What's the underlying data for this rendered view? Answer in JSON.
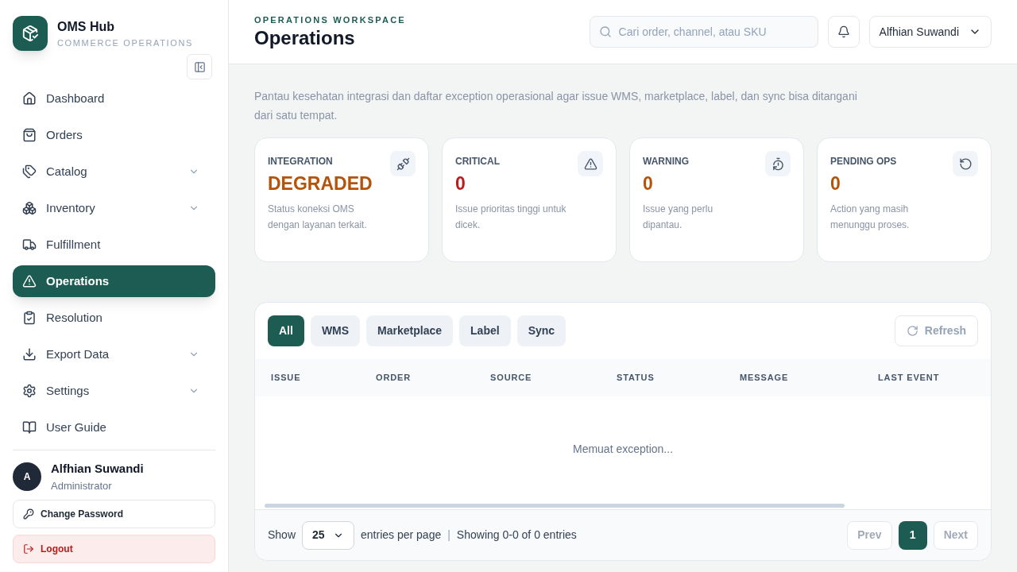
{
  "brand": {
    "name": "OMS Hub",
    "subtitle": "COMMERCE OPERATIONS"
  },
  "nav": [
    {
      "kind": "home",
      "label": "Dashboard",
      "selected": false,
      "submenu": false
    },
    {
      "kind": "orders",
      "label": "Orders",
      "selected": false,
      "submenu": false
    },
    {
      "kind": "catalog",
      "label": "Catalog",
      "selected": false,
      "submenu": true
    },
    {
      "kind": "inventory",
      "label": "Inventory",
      "selected": false,
      "submenu": true
    },
    {
      "kind": "fulfillment",
      "label": "Fulfillment",
      "selected": false,
      "submenu": false
    },
    {
      "kind": "operations",
      "label": "Operations",
      "selected": true,
      "submenu": false
    },
    {
      "kind": "resolution",
      "label": "Resolution",
      "selected": false,
      "submenu": false
    },
    {
      "kind": "export",
      "label": "Export Data",
      "selected": false,
      "submenu": true
    },
    {
      "kind": "settings",
      "label": "Settings",
      "selected": false,
      "submenu": true
    },
    {
      "kind": "guide",
      "label": "User Guide",
      "selected": false,
      "submenu": false
    }
  ],
  "user": {
    "initial": "A",
    "name": "Alfhian Suwandi",
    "role": "Administrator"
  },
  "sidebar_buttons": {
    "change_password": "Change Password",
    "logout": "Logout"
  },
  "header": {
    "eyebrow": "OPERATIONS WORKSPACE",
    "title": "Operations",
    "search_placeholder": "Cari order, channel, atau SKU",
    "user_menu": "Alfhian Suwandi"
  },
  "intro": "Pantau kesehatan integrasi dan daftar exception operasional agar issue WMS, marketplace, label, dan sync bisa ditangani dari satu tempat.",
  "stats": [
    {
      "kind": "integration",
      "label": "INTEGRATION",
      "value": "DEGRADED",
      "description": "Status koneksi OMS dengan layanan terkait."
    },
    {
      "kind": "critical",
      "label": "CRITICAL",
      "value": "0",
      "description": "Issue prioritas tinggi untuk dicek."
    },
    {
      "kind": "warning",
      "label": "WARNING",
      "value": "0",
      "description": "Issue yang perlu dipantau."
    },
    {
      "kind": "pending",
      "label": "PENDING OPS",
      "value": "0",
      "description": "Action yang masih menunggu proses."
    }
  ],
  "filters": [
    {
      "label": "All",
      "selected": true
    },
    {
      "label": "WMS",
      "selected": false
    },
    {
      "label": "Marketplace",
      "selected": false
    },
    {
      "label": "Label",
      "selected": false
    },
    {
      "label": "Sync",
      "selected": false
    }
  ],
  "refresh": {
    "label": "Refresh",
    "disabled": true
  },
  "table": {
    "columns": [
      "ISSUE",
      "ORDER",
      "SOURCE",
      "STATUS",
      "MESSAGE",
      "LAST EVENT"
    ],
    "empty_message": "Memuat exception..."
  },
  "footer": {
    "show": "Show",
    "page_size": "25",
    "per_page": "entries per page",
    "separator": "|",
    "summary": "Showing 0-0 of 0 entries"
  },
  "pagination": [
    {
      "label": "Prev",
      "disabled": true,
      "selected": false
    },
    {
      "label": "1",
      "disabled": false,
      "selected": true
    },
    {
      "label": "Next",
      "disabled": true,
      "selected": false
    }
  ]
}
